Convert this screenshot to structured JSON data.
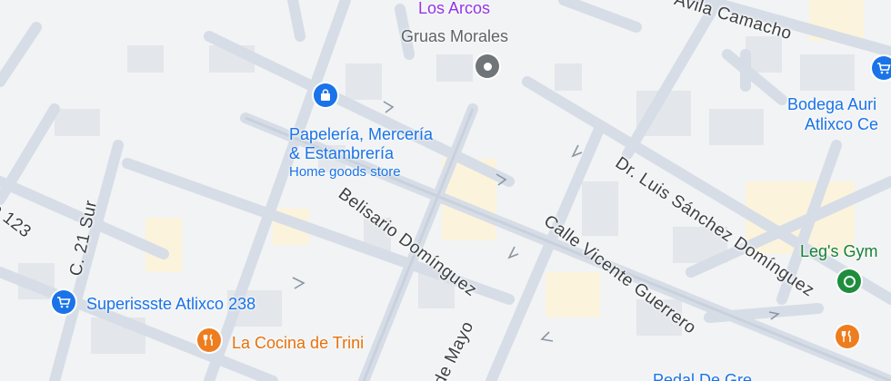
{
  "map": {
    "streets": {
      "avila_camacho": "Avila Camacho",
      "dr_luis": "Dr. Luis Sánchez Domínguez",
      "vicente_guerrero": "Calle Vicente Guerrero",
      "belisario": "Belisario Domínguez",
      "c21_sur": "C. 21 Sur",
      "num_123": "o 123",
      "de_mayo": "de Mayo",
      "los_arcos": "Los Arcos"
    },
    "places": {
      "gruas": "Gruas Morales",
      "papeleria_line1": "Papelería, Mercería",
      "papeleria_line2": "& Estambrería",
      "papeleria_category": "Home goods store",
      "superissste": "Superissste Atlixco 238",
      "cocina": "La Cocina de Trini",
      "bodega_line1": "Bodega Auri",
      "bodega_line2": "Atlixco Ce",
      "legs": "Leg's Gym",
      "bottom_partial": "Pedal De Gre"
    },
    "icons": {
      "gruas": "pin-icon",
      "papeleria": "shopping-bag-icon",
      "superissste": "shopping-cart-icon",
      "cocina": "restaurant-icon",
      "bodega": "shopping-cart-icon",
      "legs": "gym-icon"
    },
    "colors": {
      "land": "#f1f3f4",
      "road": "#d6dde6",
      "road_major": "#c5d0dc",
      "block": "#e3e6ea",
      "yellow_block": "#fbf3dc",
      "poi_blue": "#1a73e8",
      "poi_orange": "#e8710a",
      "poi_green": "#188038",
      "poi_grey": "#5f6368"
    }
  }
}
